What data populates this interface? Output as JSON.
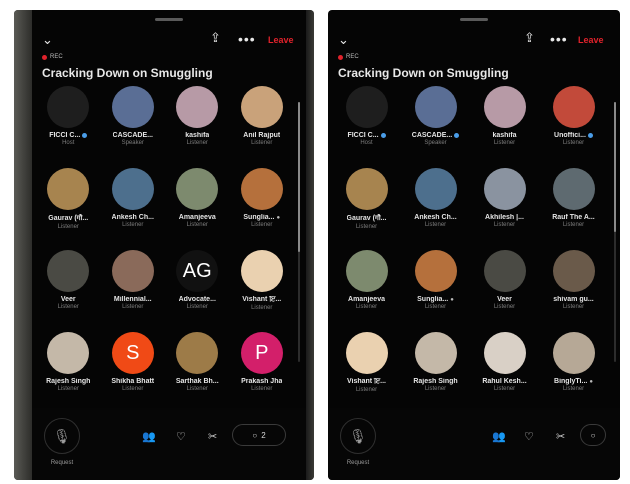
{
  "header": {
    "collapse_icon": "chevron-down-icon",
    "share_icon": "share-icon",
    "more_label": "•••",
    "leave_label": "Leave",
    "rec_label": "REC",
    "title": "Cracking Down on Smuggling"
  },
  "left_panel": {
    "participants": [
      {
        "name": "FICCI C...",
        "role": "Host",
        "badge": true,
        "avatar_text": "",
        "color": "#1e1e1e"
      },
      {
        "name": "CASCADE...",
        "role": "Speaker",
        "badge": false,
        "avatar_text": "",
        "color": "#5a6e95"
      },
      {
        "name": "kashifa",
        "role": "Listener",
        "badge": false,
        "avatar_text": "",
        "color": "#b79aa6"
      },
      {
        "name": "Anil Rajput",
        "role": "Listener",
        "badge": false,
        "avatar_text": "",
        "color": "#c9a27a"
      },
      {
        "name": "Gaurav (गौ...",
        "role": "Listener",
        "badge": false,
        "avatar_text": "",
        "color": "#a7844f"
      },
      {
        "name": "Ankesh Ch...",
        "role": "Listener",
        "badge": false,
        "avatar_text": "",
        "color": "#4d6f8d"
      },
      {
        "name": "Amanjeeva",
        "role": "Listener",
        "badge": false,
        "avatar_text": "",
        "color": "#7d8a6e"
      },
      {
        "name": "Sunglia...",
        "role": "Listener",
        "badge": false,
        "mic_off": true,
        "avatar_text": "",
        "color": "#b5703c"
      },
      {
        "name": "Veer",
        "role": "Listener",
        "badge": false,
        "avatar_text": "",
        "color": "#4a4a44"
      },
      {
        "name": "Millennial...",
        "role": "Listener",
        "badge": false,
        "avatar_text": "",
        "color": "#8a6a5a"
      },
      {
        "name": "Advocate...",
        "role": "Listener",
        "badge": false,
        "avatar_text": "AG",
        "color": "#111111"
      },
      {
        "name": "Vishant ਇ...",
        "role": "Listener",
        "badge": false,
        "avatar_text": "",
        "color": "#ead1b0"
      },
      {
        "name": "Rajesh Singh",
        "role": "Listener",
        "badge": false,
        "avatar_text": "",
        "color": "#c4b8a8"
      },
      {
        "name": "Shikha Bhatt",
        "role": "Listener",
        "badge": false,
        "avatar_text": "S",
        "color": "#f04a16"
      },
      {
        "name": "Sarthak Bh...",
        "role": "Listener",
        "badge": false,
        "avatar_text": "",
        "color": "#9d7b48"
      },
      {
        "name": "Prakash Jha",
        "role": "Listener",
        "badge": false,
        "avatar_text": "P",
        "color": "#d31f6a"
      }
    ],
    "bottom": {
      "request_label": "Request",
      "replies_count": "2"
    }
  },
  "right_panel": {
    "participants": [
      {
        "name": "FICCI C...",
        "role": "Host",
        "badge": true,
        "avatar_text": "",
        "color": "#1e1e1e"
      },
      {
        "name": "CASCADE...",
        "role": "Speaker",
        "badge": true,
        "avatar_text": "",
        "color": "#5a6e95"
      },
      {
        "name": "kashifa",
        "role": "Listener",
        "badge": false,
        "avatar_text": "",
        "color": "#b79aa6"
      },
      {
        "name": "Unoffici...",
        "role": "Listener",
        "badge": true,
        "avatar_text": "",
        "color": "#c24a3a"
      },
      {
        "name": "Gaurav (गौ...",
        "role": "Listener",
        "badge": false,
        "avatar_text": "",
        "color": "#a7844f"
      },
      {
        "name": "Ankesh Ch...",
        "role": "Listener",
        "badge": false,
        "avatar_text": "",
        "color": "#4d6f8d"
      },
      {
        "name": "Akhilesh |...",
        "role": "Listener",
        "badge": false,
        "avatar_text": "",
        "color": "#8a93a0"
      },
      {
        "name": "Rauf The A...",
        "role": "Listener",
        "badge": false,
        "avatar_text": "",
        "color": "#5e6a70"
      },
      {
        "name": "Amanjeeva",
        "role": "Listener",
        "badge": false,
        "avatar_text": "",
        "color": "#7d8a6e"
      },
      {
        "name": "Sunglia...",
        "role": "Listener",
        "badge": false,
        "mic_off": true,
        "avatar_text": "",
        "color": "#b5703c"
      },
      {
        "name": "Veer",
        "role": "Listener",
        "badge": false,
        "avatar_text": "",
        "color": "#4a4a44"
      },
      {
        "name": "shivam gu...",
        "role": "Listener",
        "badge": false,
        "avatar_text": "",
        "color": "#6a5a4a"
      },
      {
        "name": "Vishant ਇ...",
        "role": "Listener",
        "badge": false,
        "avatar_text": "",
        "color": "#ead1b0"
      },
      {
        "name": "Rajesh Singh",
        "role": "Listener",
        "badge": false,
        "avatar_text": "",
        "color": "#c4b8a8"
      },
      {
        "name": "Rahul Kesh...",
        "role": "Listener",
        "badge": false,
        "avatar_text": "",
        "color": "#d9d0c6"
      },
      {
        "name": "BinglyTi...",
        "role": "Listener",
        "badge": false,
        "mic_off": true,
        "avatar_text": "",
        "color": "#b6a896"
      }
    ],
    "bottom": {
      "request_label": "Request",
      "replies_count": ""
    }
  },
  "icons": {
    "mic": "microphone-icon",
    "people": "people-icon",
    "heart": "heart-icon",
    "scissors": "clip-icon",
    "replies": "comment-icon"
  },
  "colors": {
    "accent": "#e0222b",
    "verified": "#4a9de8",
    "background": "#050505"
  }
}
